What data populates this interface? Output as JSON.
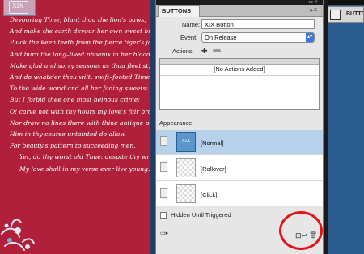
{
  "document": {
    "corner_icon_text": "XIX",
    "poem": [
      {
        "text": "Devouring Time, blunt thou the lion's paws,",
        "indent": false
      },
      {
        "text": "And make the earth devour her own sweet brood;",
        "indent": false
      },
      {
        "text": "Pluck the keen teeth from the fierce tiger's jaws,",
        "indent": false
      },
      {
        "text": "And burn the long–lived phoenix in her blood;",
        "indent": false
      },
      {
        "text": "Make glad and sorry seasons as thou fleet'st,",
        "indent": false
      },
      {
        "text": "And do whate'er thou wilt, swift–footed Time,",
        "indent": false
      },
      {
        "text": "To the wide world and all her fading sweets;",
        "indent": false
      },
      {
        "text": "But I forbid thee one most heinous crime:",
        "indent": false
      },
      {
        "text": "O! carve not with thy hours my love's fair brow,",
        "indent": false
      },
      {
        "text": "Nor draw no lines there with thine antique pen;",
        "indent": false
      },
      {
        "text": "Him in thy course untainted do allow",
        "indent": false
      },
      {
        "text": "For beauty's pattern to succeeding men.",
        "indent": false
      },
      {
        "text": "Yet, do thy worst old Time: despite thy wrong,",
        "indent": true
      },
      {
        "text": "My love shall in my verse ever live young.",
        "indent": true
      }
    ]
  },
  "panel": {
    "tab_title": "BUTTONS",
    "name_label": "Name:",
    "name_value": "XIX Button",
    "event_label": "Event:",
    "event_value": "On Release",
    "actions_label": "Actions:",
    "actions_empty": "[No Actions Added]",
    "appearance_label": "Appearance",
    "appearances": [
      {
        "name": "[Normal]",
        "thumb_text": "XIX",
        "selected": true
      },
      {
        "name": "[Rollover]",
        "thumb_text": "",
        "selected": false
      },
      {
        "name": "[Click]",
        "thumb_text": "",
        "selected": false
      }
    ],
    "hidden_label": "Hidden Until Triggered",
    "hidden_checked": false
  },
  "right_panel": {
    "tab_title": "BUTTO"
  },
  "colors": {
    "document_bg": "#b0203a",
    "selection": "#b7d1ea",
    "highlight_circle": "#e0141b",
    "accent": "#3b7ad9"
  },
  "icons": {
    "add_action": "plus-icon",
    "remove_action": "minus-icon",
    "preview": "preview-icon",
    "convert": "convert-to-object-icon",
    "trash": "trash-icon",
    "eye": "eye-icon"
  }
}
